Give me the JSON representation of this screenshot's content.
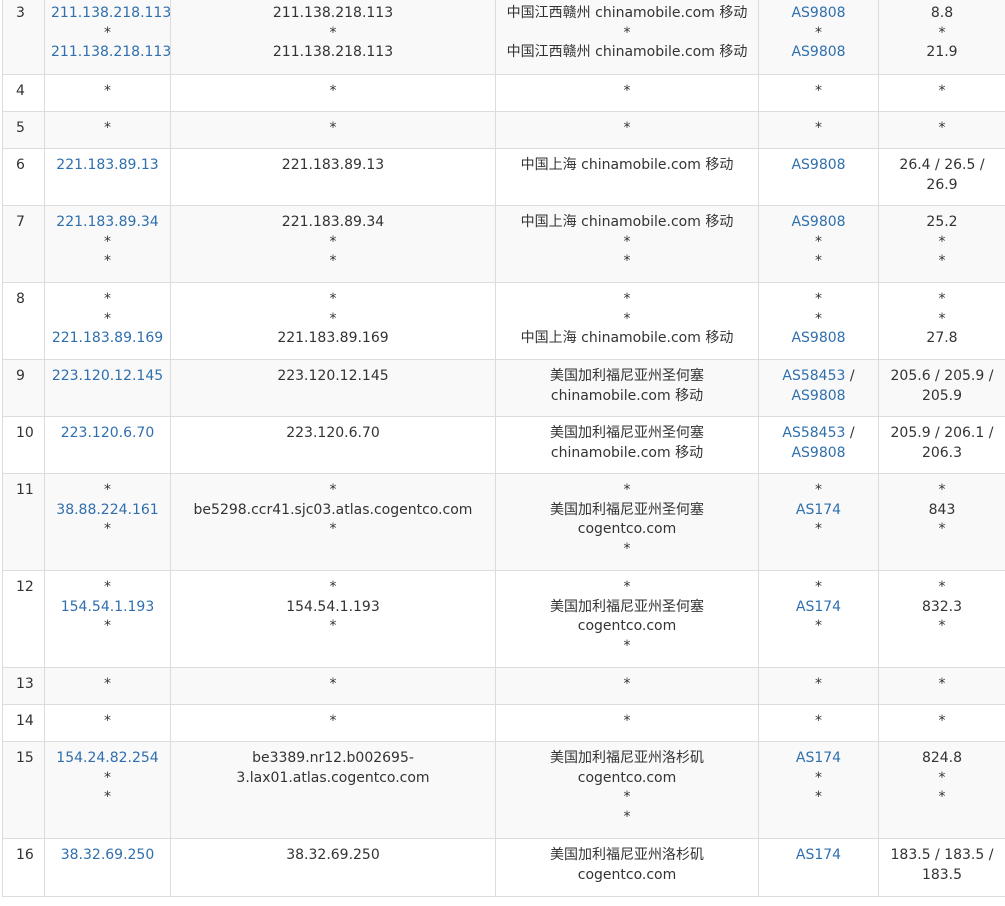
{
  "rows": [
    {
      "hop": "3",
      "ip": [
        "211.138.218.113",
        "*",
        "211.138.218.113"
      ],
      "host": [
        "211.138.218.113",
        "*",
        "211.138.218.113"
      ],
      "loc": [
        "中国江西赣州 chinamobile.com 移动",
        "*",
        "中国江西赣州 chinamobile.com 移动"
      ],
      "asn": [
        [
          "AS9808"
        ],
        [
          "*"
        ],
        [
          "AS9808"
        ]
      ],
      "rtt": [
        "8.8",
        "*",
        "21.9"
      ],
      "h": 78
    },
    {
      "hop": "4",
      "ip": [
        "*"
      ],
      "host": [
        "*"
      ],
      "loc": [
        "*"
      ],
      "asn": [
        [
          "*"
        ]
      ],
      "rtt": [
        "*"
      ],
      "h": 37
    },
    {
      "hop": "5",
      "ip": [
        "*"
      ],
      "host": [
        "*"
      ],
      "loc": [
        "*"
      ],
      "asn": [
        [
          "*"
        ]
      ],
      "rtt": [
        "*"
      ],
      "h": 37
    },
    {
      "hop": "6",
      "ip": [
        "221.183.89.13"
      ],
      "host": [
        "221.183.89.13"
      ],
      "loc": [
        "中国上海 chinamobile.com 移动"
      ],
      "asn": [
        [
          "AS9808"
        ]
      ],
      "rtt": [
        "26.4 / 26.5 /",
        "26.9"
      ],
      "h": 57
    },
    {
      "hop": "7",
      "ip": [
        "221.183.89.34",
        "*",
        "*"
      ],
      "host": [
        "221.183.89.34",
        "*",
        "*"
      ],
      "loc": [
        "中国上海 chinamobile.com 移动",
        "*",
        "*"
      ],
      "asn": [
        [
          "AS9808"
        ],
        [
          "*"
        ],
        [
          "*"
        ]
      ],
      "rtt": [
        "25.2",
        "*",
        "*"
      ],
      "h": 77
    },
    {
      "hop": "8",
      "ip": [
        "*",
        "*",
        "221.183.89.169"
      ],
      "host": [
        "*",
        "*",
        "221.183.89.169"
      ],
      "loc": [
        "*",
        "*",
        "中国上海 chinamobile.com 移动"
      ],
      "asn": [
        [
          "*"
        ],
        [
          "*"
        ],
        [
          "AS9808"
        ]
      ],
      "rtt": [
        "*",
        "*",
        "27.8"
      ],
      "h": 77
    },
    {
      "hop": "9",
      "ip": [
        "223.120.12.145"
      ],
      "host": [
        "223.120.12.145"
      ],
      "loc": [
        "美国加利福尼亚州圣何塞",
        "chinamobile.com 移动"
      ],
      "asn": [
        [
          "AS58453",
          " /"
        ],
        [
          "AS9808"
        ]
      ],
      "rtt": [
        "205.6 / 205.9 /",
        "205.9"
      ],
      "h": 57
    },
    {
      "hop": "10",
      "ip": [
        "223.120.6.70"
      ],
      "host": [
        "223.120.6.70"
      ],
      "loc": [
        "美国加利福尼亚州圣何塞",
        "chinamobile.com 移动"
      ],
      "asn": [
        [
          "AS58453",
          " /"
        ],
        [
          "AS9808"
        ]
      ],
      "rtt": [
        "205.9 / 206.1 /",
        "206.3"
      ],
      "h": 57
    },
    {
      "hop": "11",
      "ip": [
        "*",
        "38.88.224.161",
        "*"
      ],
      "host": [
        "*",
        "be5298.ccr41.sjc03.atlas.cogentco.com",
        "*"
      ],
      "loc": [
        "*",
        "美国加利福尼亚州圣何塞",
        "cogentco.com",
        "*"
      ],
      "asn": [
        [
          "*"
        ],
        [
          "AS174"
        ],
        [
          "*"
        ]
      ],
      "rtt": [
        "*",
        "843",
        "*"
      ],
      "h": 97
    },
    {
      "hop": "12",
      "ip": [
        "*",
        "154.54.1.193",
        "*"
      ],
      "host": [
        "*",
        "154.54.1.193",
        "*"
      ],
      "loc": [
        "*",
        "美国加利福尼亚州圣何塞",
        "cogentco.com",
        "*"
      ],
      "asn": [
        [
          "*"
        ],
        [
          "AS174"
        ],
        [
          "*"
        ]
      ],
      "rtt": [
        "*",
        "832.3",
        "*"
      ],
      "h": 97
    },
    {
      "hop": "13",
      "ip": [
        "*"
      ],
      "host": [
        "*"
      ],
      "loc": [
        "*"
      ],
      "asn": [
        [
          "*"
        ]
      ],
      "rtt": [
        "*"
      ],
      "h": 37
    },
    {
      "hop": "14",
      "ip": [
        "*"
      ],
      "host": [
        "*"
      ],
      "loc": [
        "*"
      ],
      "asn": [
        [
          "*"
        ]
      ],
      "rtt": [
        "*"
      ],
      "h": 37
    },
    {
      "hop": "15",
      "ip": [
        "154.24.82.254",
        "*",
        "*"
      ],
      "host": [
        "be3389.nr12.b002695-",
        "3.lax01.atlas.cogentco.com"
      ],
      "loc": [
        "美国加利福尼亚州洛杉矶",
        "cogentco.com",
        "*",
        "*"
      ],
      "asn": [
        [
          "AS174"
        ],
        [
          "*"
        ],
        [
          "*"
        ]
      ],
      "rtt": [
        "824.8",
        "*",
        "*"
      ],
      "h": 97
    },
    {
      "hop": "16",
      "ip": [
        "38.32.69.250"
      ],
      "host": [
        "38.32.69.250"
      ],
      "loc": [
        "美国加利福尼亚州洛杉矶",
        "cogentco.com"
      ],
      "asn": [
        [
          "AS174"
        ]
      ],
      "rtt": [
        "183.5 / 183.5 /",
        "183.5"
      ],
      "h": 58
    }
  ]
}
